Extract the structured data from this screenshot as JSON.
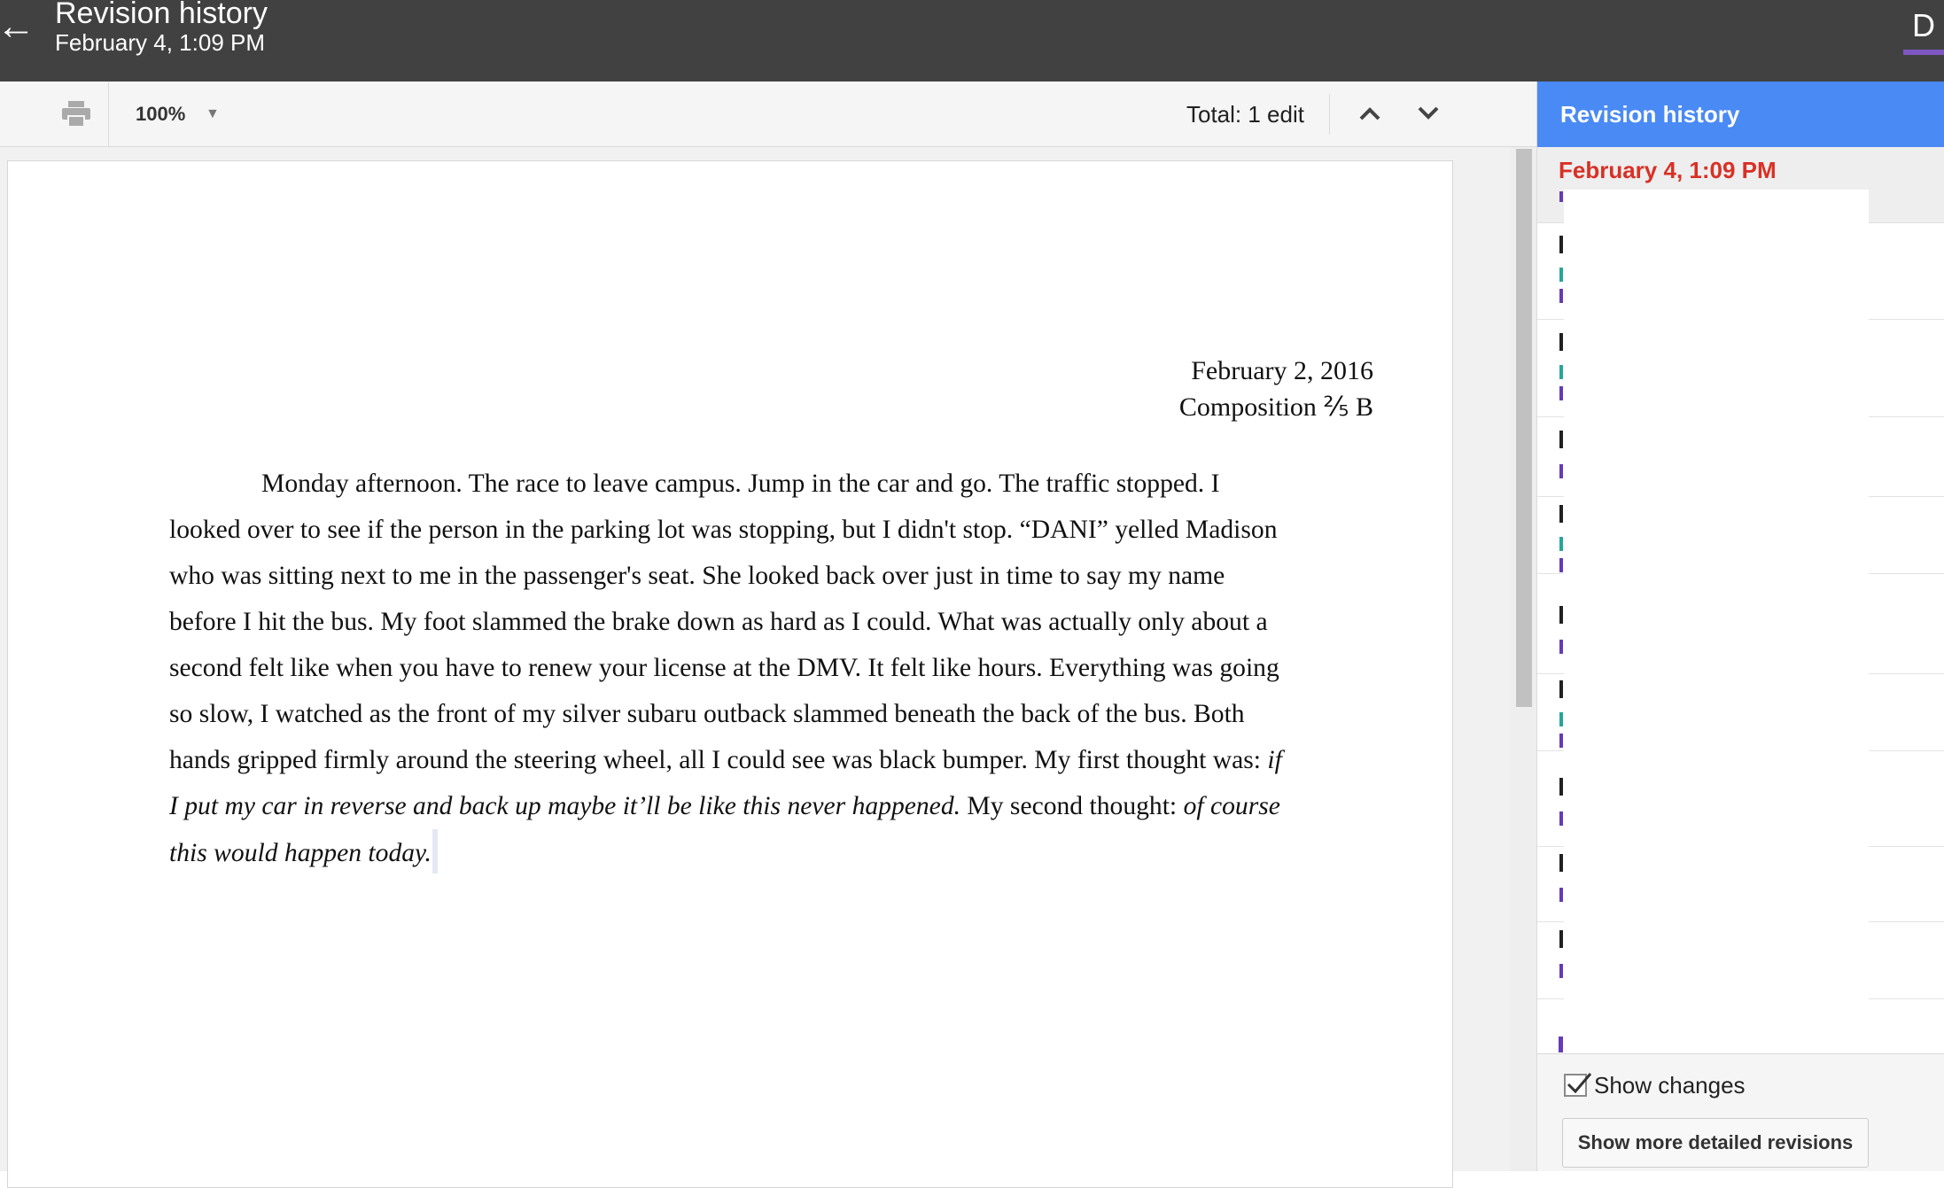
{
  "topbar": {
    "title": "Revision history",
    "subtitle": "February 4, 1:09 PM",
    "back_icon": "arrow-left-icon",
    "avatar_letter": "D"
  },
  "toolbar": {
    "print_icon": "print-icon",
    "zoom": "100%",
    "total_edits": "Total: 1 edit",
    "prev_icon": "chevron-up-icon",
    "next_icon": "chevron-down-icon"
  },
  "document": {
    "date": "February 2, 2016",
    "course": "Composition ⅖ B",
    "paragraph_plain": "Monday afternoon.  The race to leave campus. Jump in the car and go. The traffic stopped. I looked over to see if the person in the parking lot was stopping, but I didn't stop. “DANI” yelled Madison who was sitting next to me in the passenger's seat. She looked back over just in time to say my name before I hit the bus. My foot slammed the brake down as hard as I could. What was actually only about a second felt like when you have to renew your license at the DMV.  It felt like hours. Everything was going so slow, I watched as the front of my silver subaru outback slammed beneath the back of the bus. Both hands gripped firmly around the steering wheel, all I could see was black bumper. My first thought was: ",
    "italic_1": "if I put my car in reverse and back up maybe it’ll be like this never happened.",
    "plain_2": " My second thought: ",
    "italic_2": "of course this would happen today."
  },
  "sidebar": {
    "header": "Revision history",
    "selected_revision": "February 4, 1:09 PM",
    "show_changes_label": "Show changes",
    "show_changes_checked": true,
    "more_button": "Show more detailed revisions"
  },
  "colors": {
    "topbar": "#414141",
    "sidebar_header": "#4a8af4",
    "selected_date": "#d93025",
    "author_purple": "#673ab7",
    "author_teal": "#26a69a"
  }
}
